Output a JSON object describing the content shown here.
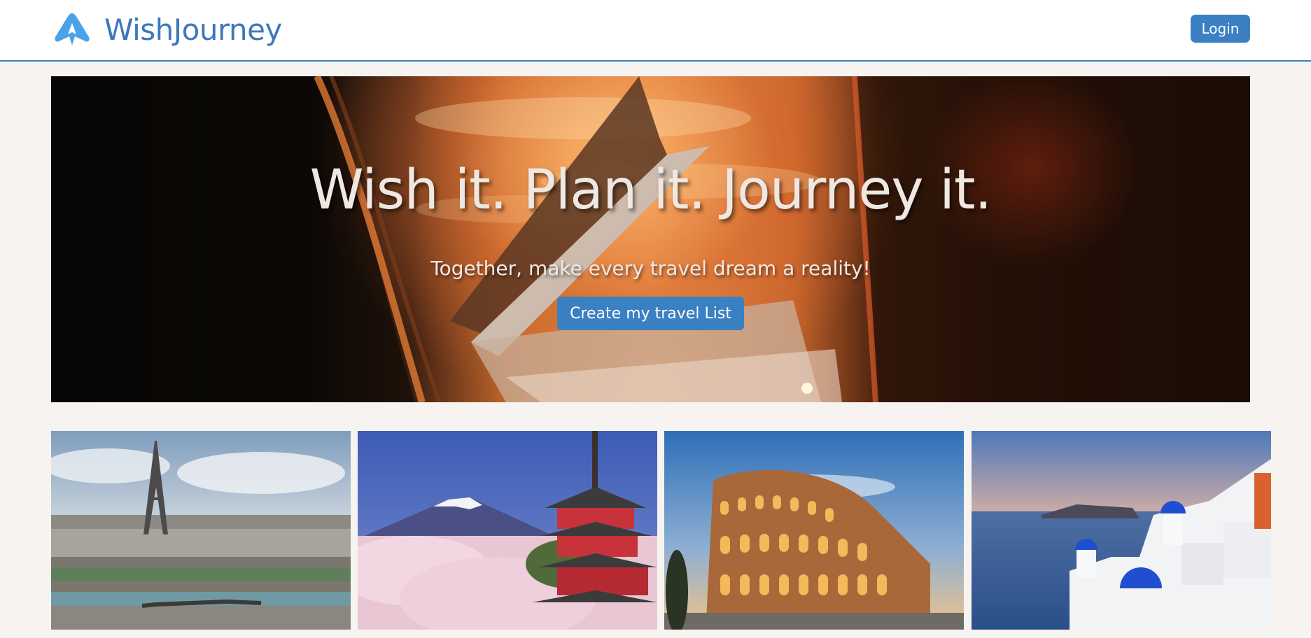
{
  "app": {
    "name": "WishJourney",
    "brand_color": "#3d78bb",
    "logo_icon": "airplane-icon"
  },
  "header": {
    "login_label": "Login"
  },
  "hero": {
    "title": "Wish it. Plan it. Journey it.",
    "subtitle": "Together, make every travel dream a reality!",
    "cta_label": "Create my travel List"
  },
  "destinations": [
    {
      "scene": "paris-eiffel-tower"
    },
    {
      "scene": "japan-mount-fuji-pagoda"
    },
    {
      "scene": "rome-colosseum"
    },
    {
      "scene": "santorini-blue-domes"
    }
  ]
}
